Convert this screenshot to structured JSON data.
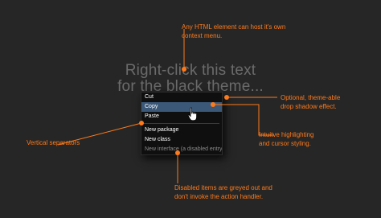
{
  "background_color": "#262626",
  "accent_color": "#ff7a1a",
  "headline": {
    "line1": "Right-click this text",
    "line2": "for the black theme..."
  },
  "context_menu": {
    "highlight_color": "#3b5878",
    "items": [
      {
        "label": "Cut",
        "state": "normal"
      },
      {
        "label": "Copy",
        "state": "highlighted"
      },
      {
        "label": "Paste",
        "state": "normal"
      },
      {
        "label": "New package",
        "state": "normal"
      },
      {
        "label": "New class",
        "state": "normal"
      },
      {
        "label": "New interface (a disabled entry)",
        "state": "disabled"
      }
    ]
  },
  "annotations": {
    "context_menu_host": [
      "Any HTML element can host it's own",
      "context menu."
    ],
    "drop_shadow": [
      "Optional, theme-able",
      "drop shadow effect."
    ],
    "highlighting": [
      "Intuitve highlighting",
      "and cursor styling."
    ],
    "separators": [
      "Vertical separators"
    ],
    "disabled_items": [
      "Disabled items are greyed out and",
      "don't invoke the action handler."
    ]
  }
}
